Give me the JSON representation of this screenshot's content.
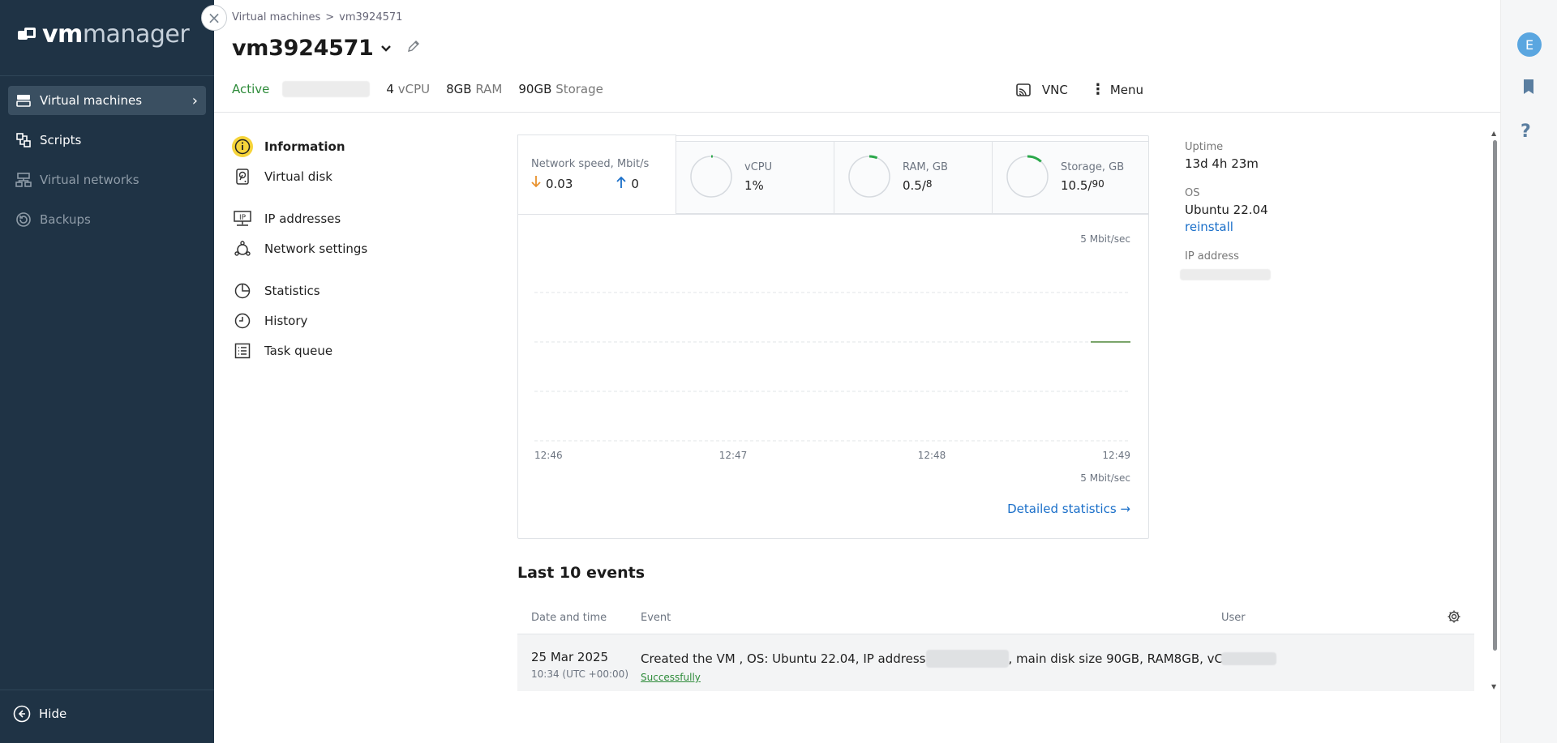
{
  "logo": {
    "vm": "vm",
    "manager": "manager"
  },
  "sidebar": {
    "items": [
      {
        "label": "Virtual machines",
        "icon": "server-icon",
        "active": true,
        "disabled": false,
        "chevron": "›"
      },
      {
        "label": "Scripts",
        "icon": "scripts-icon",
        "active": false,
        "disabled": false
      },
      {
        "label": "Virtual networks",
        "icon": "network-icon",
        "active": false,
        "disabled": true
      },
      {
        "label": "Backups",
        "icon": "backup-icon",
        "active": false,
        "disabled": true
      }
    ],
    "hide_label": "Hide"
  },
  "breadcrumb": {
    "parent": "Virtual machines",
    "separator": ">",
    "current": "vm3924571"
  },
  "header": {
    "title": "vm3924571",
    "status": "Active",
    "vcpu_value": "4",
    "vcpu_unit": "vCPU",
    "ram_value": "8GB",
    "ram_unit": "RAM",
    "storage_value": "90GB",
    "storage_unit": "Storage",
    "vnc_label": "VNC",
    "menu_label": "Menu"
  },
  "subnav": [
    {
      "label": "Information",
      "icon": "info-icon",
      "active": true
    },
    {
      "label": "Virtual disk",
      "icon": "disk-icon",
      "active": false
    },
    {
      "label": "IP addresses",
      "icon": "ip-icon",
      "active": false
    },
    {
      "label": "Network settings",
      "icon": "network-settings-icon",
      "active": false
    },
    {
      "label": "Statistics",
      "icon": "pie-chart-icon",
      "active": false
    },
    {
      "label": "History",
      "icon": "clock-icon",
      "active": false
    },
    {
      "label": "Task queue",
      "icon": "list-icon",
      "active": false
    }
  ],
  "stats": {
    "network": {
      "title": "Network speed, Mbit/s",
      "down": "0.03",
      "up": "0"
    },
    "vcpu": {
      "title": "vCPU",
      "value": "1%",
      "fraction": 0.01
    },
    "ram": {
      "title": "RAM, GB",
      "used": "0.5/",
      "total": "8",
      "fraction": 0.0625
    },
    "storage": {
      "title": "Storage, GB",
      "used": "10.5/",
      "total": "90",
      "fraction": 0.1167
    }
  },
  "chart_data": {
    "type": "line",
    "x": [
      "12:46",
      "12:47",
      "12:48",
      "12:49"
    ],
    "scale_top_label": "5 Mbit/sec",
    "scale_bottom_label": "5 Mbit/sec",
    "series": [
      {
        "points": [
          [
            "12:48.8",
            0
          ],
          [
            "12:49",
            0
          ]
        ]
      }
    ],
    "grid": true
  },
  "detailed_link": "Detailed statistics →",
  "info": {
    "uptime_label": "Uptime",
    "uptime": "13d 4h 23m",
    "os_label": "OS",
    "os": "Ubuntu 22.04",
    "reinstall": "reinstall",
    "ip_label": "IP address"
  },
  "events": {
    "title": "Last 10 events",
    "columns": {
      "date": "Date and time",
      "event": "Event",
      "user": "User"
    },
    "rows": [
      {
        "date": "25 Mar 2025",
        "time": "10:34 (UTC +00:00)",
        "event_prefix": "Created the VM , OS: Ubuntu 22.04, IP address",
        "event_suffix": ", main disk size 90GB, RAM8GB, vCP…",
        "status": "Successfully"
      }
    ]
  },
  "user": {
    "avatar_letter": "E"
  },
  "colors": {
    "sidebar": "#1f3345",
    "accent": "#1a6fc9",
    "active": "#2e8b3a",
    "gauge": "#2aa84a",
    "highlight": "#f6d43a"
  }
}
